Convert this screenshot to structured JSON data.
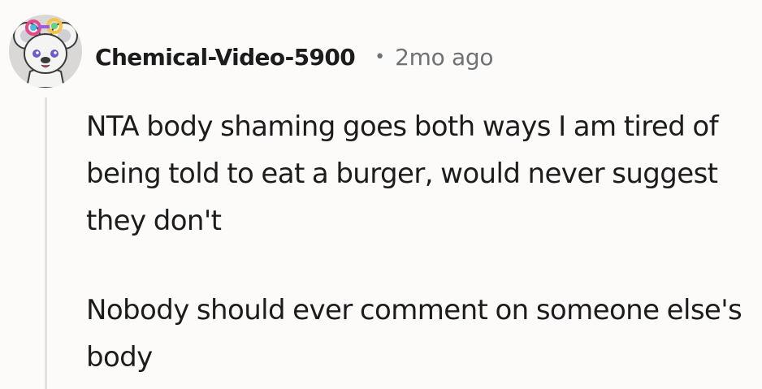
{
  "comment": {
    "author": "Chemical-Video-5900",
    "separator": "•",
    "timestamp": "2mo ago",
    "avatar_icon": "koala-avatar-icon",
    "paragraphs": [
      "NTA body shaming goes both ways I am tired of being told to eat a burger, would never suggest they don't",
      "Nobody should ever comment on someone else's body"
    ]
  },
  "colors": {
    "background": "#fcfbfa",
    "text": "#1c1c1c",
    "meta_text": "#6f7173",
    "thread_line": "#e4e2df",
    "avatar_bg": "#d9d8d6"
  }
}
